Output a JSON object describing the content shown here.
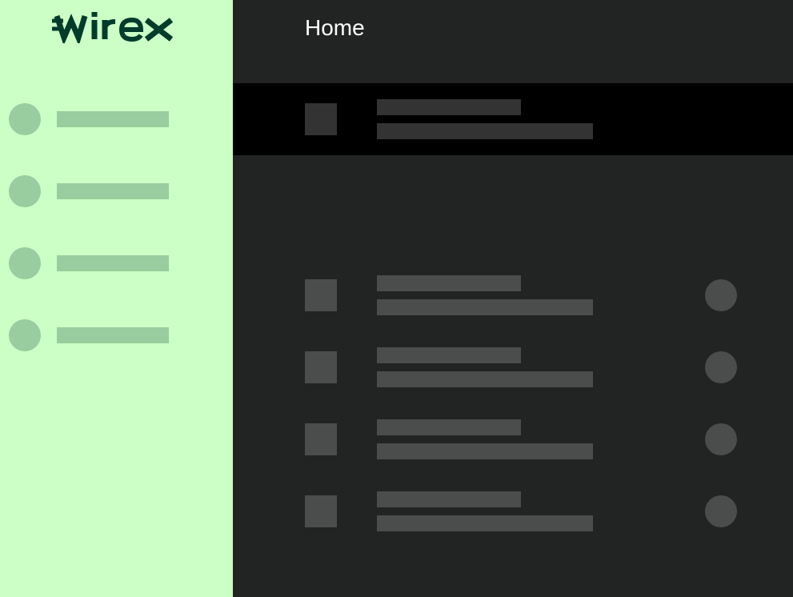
{
  "brand": {
    "name": "wirex",
    "logo_color": "#003b2b"
  },
  "colors": {
    "sidebar_bg": "#cbffc6",
    "placeholder_sidebar": "#99cc9e",
    "main_bg": "#222323",
    "featured_bg": "#000000",
    "placeholder_featured": "#333333",
    "placeholder_list": "#4b4c4c",
    "title_text": "#ffffff"
  },
  "header": {
    "title": "Home"
  },
  "sidebar": {
    "item_count": 4
  },
  "list": {
    "row_count": 4
  }
}
